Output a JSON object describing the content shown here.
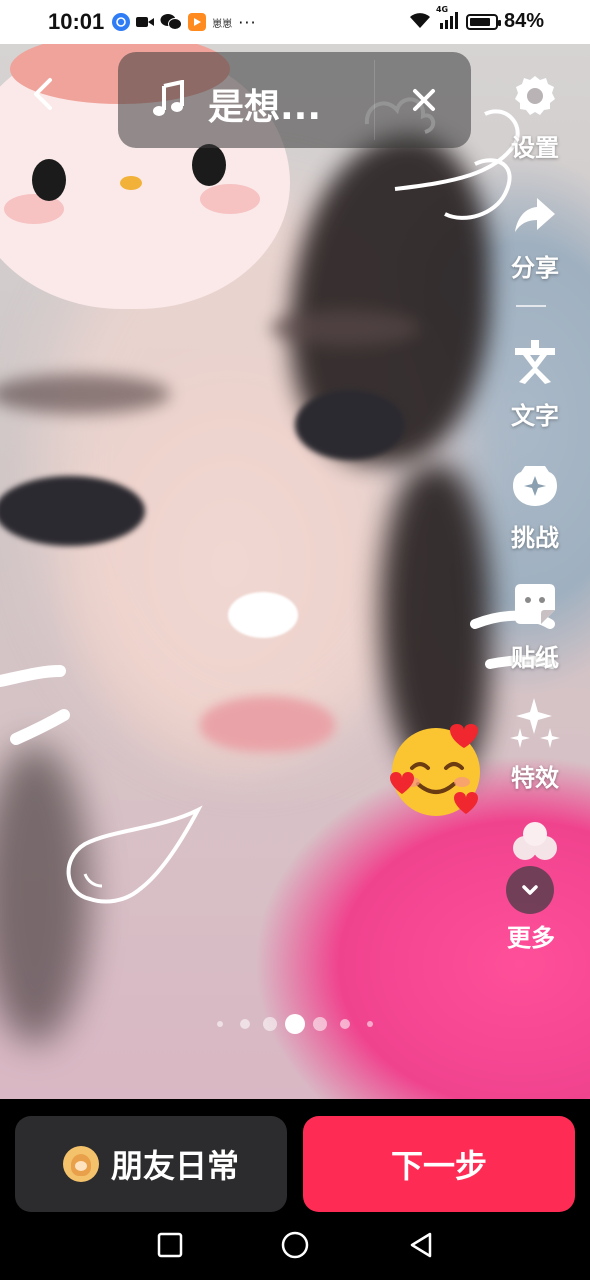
{
  "status_bar": {
    "time": "10:01",
    "extra_icon_text": "崽崽",
    "overflow": "···",
    "network": "4G",
    "battery_percent": "84%",
    "battery_level": 0.84
  },
  "top": {
    "music_title": "是想..."
  },
  "toolbar": {
    "items": [
      {
        "label": "设置",
        "icon": "gear-icon"
      },
      {
        "label": "分享",
        "icon": "share-icon"
      },
      {
        "label": "文字",
        "icon": "text-icon"
      },
      {
        "label": "挑战",
        "icon": "challenge-icon"
      },
      {
        "label": "贴纸",
        "icon": "sticker-icon"
      },
      {
        "label": "特效",
        "icon": "sparkle-icon"
      },
      {
        "label": "更多",
        "icon": "chevron-down-icon"
      }
    ]
  },
  "page_indicator": {
    "total": 7,
    "active_index": 3
  },
  "bottom": {
    "friends_label": "朋友日常",
    "next_label": "下一步"
  },
  "colors": {
    "next_button": "#fe2c55",
    "friends_button": "#2c2c2e"
  }
}
